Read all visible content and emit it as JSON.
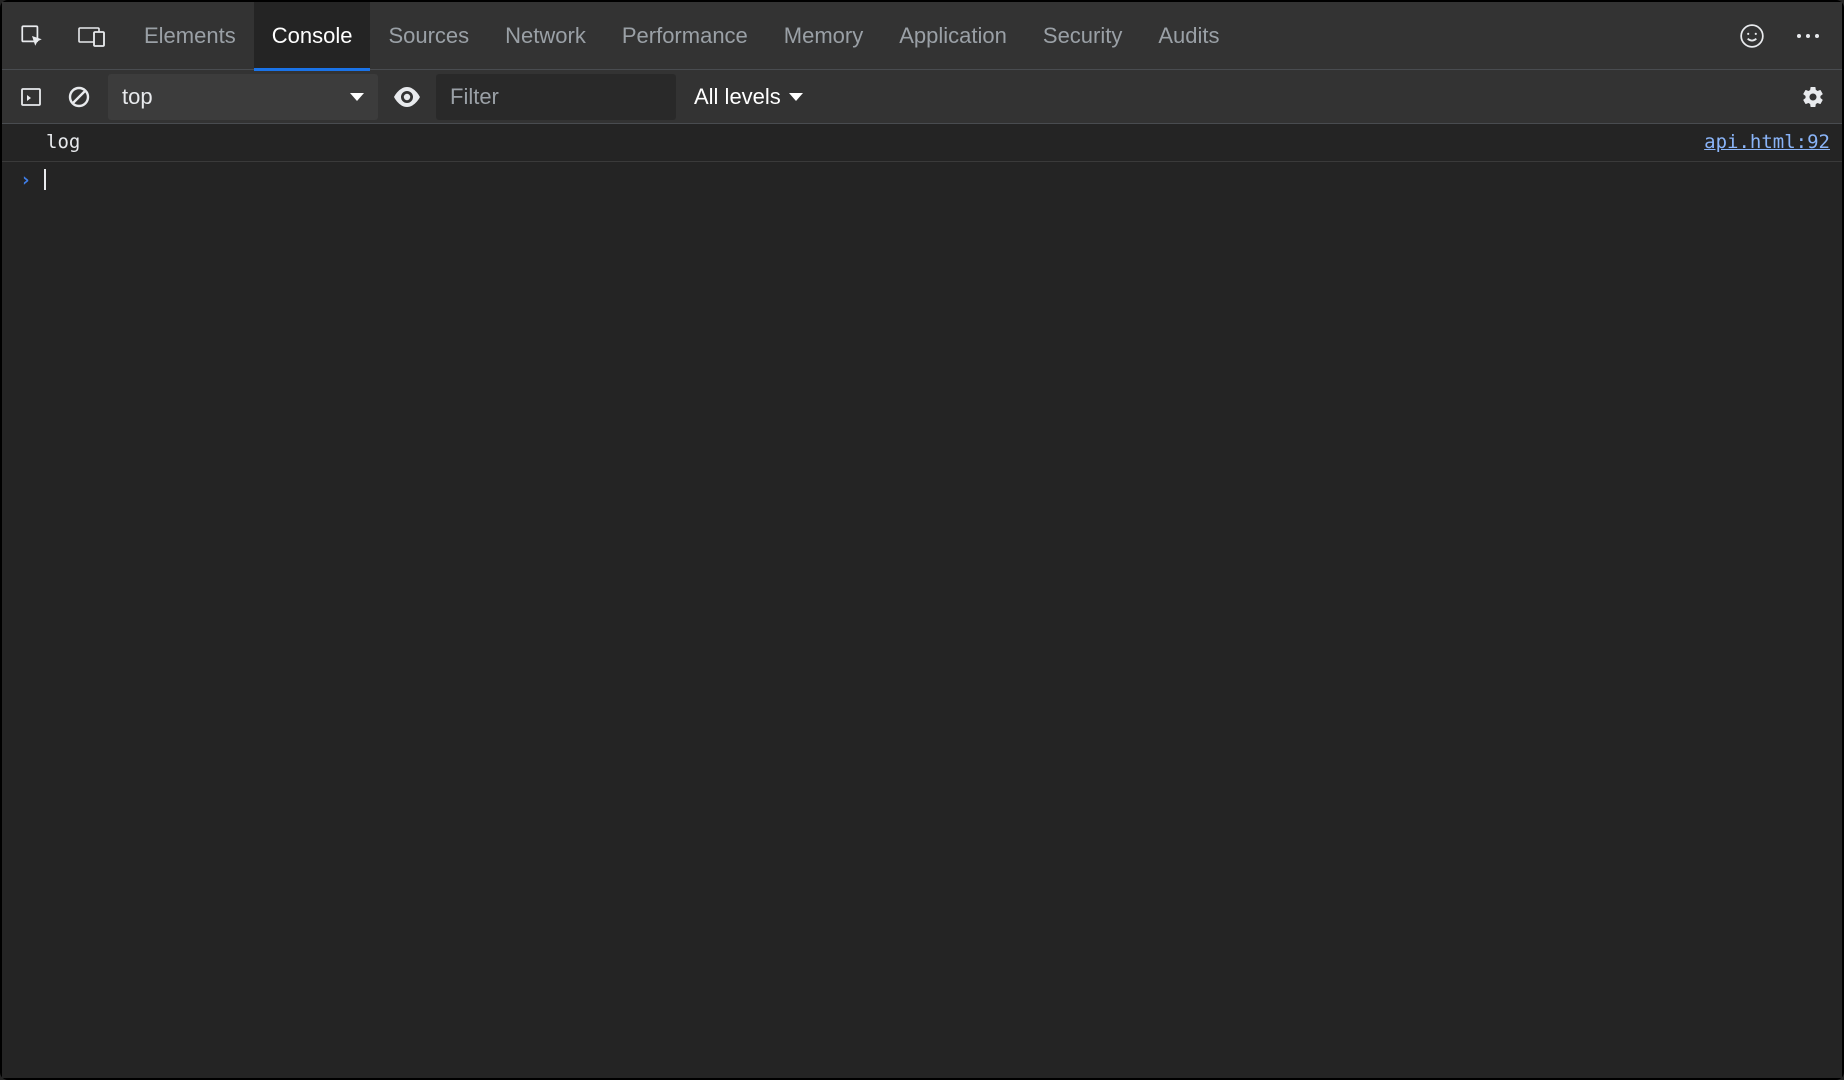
{
  "tabs": [
    {
      "label": "Elements",
      "active": false
    },
    {
      "label": "Console",
      "active": true
    },
    {
      "label": "Sources",
      "active": false
    },
    {
      "label": "Network",
      "active": false
    },
    {
      "label": "Performance",
      "active": false
    },
    {
      "label": "Memory",
      "active": false
    },
    {
      "label": "Application",
      "active": false
    },
    {
      "label": "Security",
      "active": false
    },
    {
      "label": "Audits",
      "active": false
    }
  ],
  "console_toolbar": {
    "context_value": "top",
    "filter_placeholder": "Filter",
    "levels_label": "All levels"
  },
  "console_log": {
    "message": "log",
    "source_link": "api.html:92"
  },
  "prompt_symbol": "›"
}
